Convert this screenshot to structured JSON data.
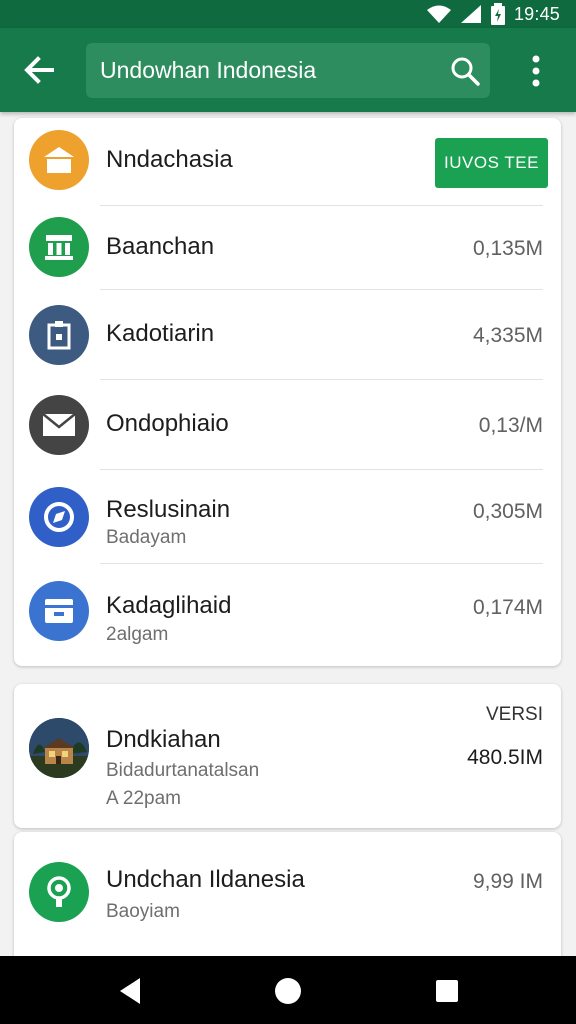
{
  "status_bar": {
    "time": "19:45"
  },
  "app_bar": {
    "search_value": "Undowhan Indonesia"
  },
  "list_card": {
    "update_button_label": "IUVOS TEE",
    "items": [
      {
        "title": "Nndachasia",
        "icon": "home-icon",
        "color": "#efa12e"
      },
      {
        "title": "Baanchan",
        "size": "0,135M",
        "icon": "bank-icon",
        "color": "#1f9e4d"
      },
      {
        "title": "Kadotiarin",
        "size": "4,335M",
        "icon": "clipboard-icon",
        "color": "#3d5a80"
      },
      {
        "title": "Ondophiaio",
        "size": "0,13/M",
        "icon": "mail-icon",
        "color": "#444444"
      },
      {
        "title": "Reslusinain",
        "subtitle": "Badayam",
        "size": "0,305M",
        "icon": "compass-icon",
        "color": "#2f5fc7"
      },
      {
        "title": "Kadaglihaid",
        "subtitle": "2algam",
        "size": "0,174M",
        "icon": "inbox-icon",
        "color": "#3a74d0"
      }
    ]
  },
  "featured_card": {
    "version_label": "VERSI",
    "title": "Dndkiahan",
    "subtitle": "Bidadurtanatalsan",
    "time": "A 22pam",
    "size": "480.5IM",
    "icon": "house-thumbnail"
  },
  "bottom_card": {
    "title": "Undchan Ildanesia",
    "subtitle": "Baoyiam",
    "size": "9,99 IM",
    "icon": "location-icon",
    "color": "#1aa152"
  },
  "nav_bar": {
    "back": "back-icon",
    "home": "home-circle-icon",
    "recents": "recents-icon"
  }
}
